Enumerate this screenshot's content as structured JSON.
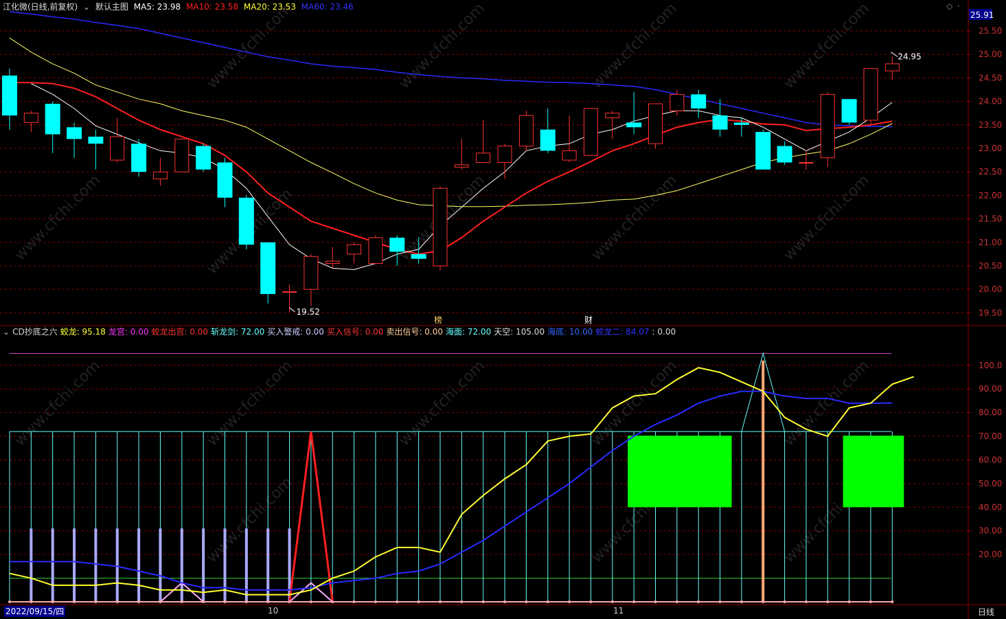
{
  "header": {
    "stock": "江化微(日线,前复权)",
    "icon": "chevron-down-icon",
    "main_label": "默认主图",
    "ma5": "MA5: 23.98",
    "ma10": "MA10: 23.58",
    "ma20": "MA20: 23.53",
    "ma60": "MA60: 23.46",
    "right_icons": [
      "diamond-icon",
      "dot-icon"
    ]
  },
  "indicator_header": {
    "icon": "chevron-down-icon",
    "name": "CD抄底之六",
    "items": [
      {
        "text": "蛟龙: 95.18",
        "color": "#ffff33"
      },
      {
        "text": "龙宫: 0.00",
        "color": "#ff33ff"
      },
      {
        "text": "蛟龙出宫: 0.00",
        "color": "#ff3333"
      },
      {
        "text": "斩龙剑: 72.00",
        "color": "#66ffff"
      },
      {
        "text": "买入警戒: 0.00",
        "color": "#ccccff"
      },
      {
        "text": "买入信号: 0.00",
        "color": "#ff3333"
      },
      {
        "text": "卖出信号: 0.00",
        "color": "#ffcc99"
      },
      {
        "text": "海面: 72.00",
        "color": "#66ffff"
      },
      {
        "text": "天空: 105.00",
        "color": "#dddddd"
      },
      {
        "text": "海底: 10.00",
        "color": "#3366ff"
      },
      {
        "text": "蛟龙二: 84.07",
        "color": "#3333ff"
      },
      {
        "text": ": 0.00",
        "color": "#dddddd"
      }
    ]
  },
  "price_axis": {
    "current": "25.91",
    "labels": [
      "25.50",
      "25.00",
      "24.50",
      "24.00",
      "23.50",
      "23.00",
      "22.50",
      "22.00",
      "21.50",
      "21.00",
      "20.50",
      "20.00",
      "19.50"
    ]
  },
  "indicator_axis": {
    "labels": [
      "100.0",
      "90.00",
      "80.00",
      "70.00",
      "60.00",
      "50.00",
      "40.00",
      "30.00",
      "20.00"
    ]
  },
  "annotations": {
    "high": "24.95",
    "low": "19.52",
    "marker1": "榜",
    "marker2": "财"
  },
  "bottom": {
    "date": "2022/09/15/四",
    "month_oct": "10",
    "month_nov": "11",
    "period": "日线"
  },
  "watermark": "www.cfchi.com",
  "colors": {
    "up": "#ff3232",
    "down": "#00ffff",
    "ma5": "#ffffff",
    "ma10": "#ff2020",
    "ma20": "#ffff66",
    "ma60": "#2a2aff",
    "grid": "#8b0000",
    "sky": "#cc44cc",
    "sea": "#66ffff",
    "seabed": "#33cc33",
    "jiaolong": "#ffff33",
    "jiaolong2": "#2a2aff",
    "green_block": "#00ff00",
    "sell": "#ffaa77",
    "alert": "#aaaaff"
  },
  "chart_data": {
    "type": "candlestick",
    "ylim": [
      19.3,
      25.91
    ],
    "candles": [
      [
        24.55,
        23.7,
        24.7,
        23.4
      ],
      [
        23.55,
        23.75,
        23.8,
        23.35
      ],
      [
        23.95,
        23.3,
        24.0,
        22.9
      ],
      [
        23.45,
        23.2,
        23.55,
        22.8
      ],
      [
        23.25,
        23.1,
        23.4,
        22.55
      ],
      [
        22.75,
        23.25,
        23.65,
        22.7
      ],
      [
        23.1,
        22.5,
        23.2,
        22.4
      ],
      [
        22.35,
        22.5,
        22.8,
        22.2
      ],
      [
        22.5,
        23.2,
        23.2,
        22.5
      ],
      [
        23.05,
        22.55,
        23.1,
        22.5
      ],
      [
        22.7,
        21.95,
        22.8,
        21.75
      ],
      [
        21.95,
        20.95,
        22.0,
        20.85
      ],
      [
        21.0,
        19.9,
        21.0,
        19.7
      ],
      [
        19.95,
        19.95,
        20.1,
        19.52
      ],
      [
        20.0,
        20.7,
        20.75,
        19.65
      ],
      [
        20.55,
        20.6,
        20.9,
        20.45
      ],
      [
        20.75,
        20.95,
        21.0,
        20.55
      ],
      [
        20.55,
        21.1,
        21.15,
        20.55
      ],
      [
        21.1,
        20.8,
        21.15,
        20.5
      ],
      [
        20.75,
        20.65,
        21.1,
        20.55
      ],
      [
        20.5,
        22.15,
        22.2,
        20.4
      ],
      [
        22.6,
        22.65,
        23.2,
        22.55
      ],
      [
        22.7,
        22.9,
        23.6,
        22.7
      ],
      [
        22.7,
        23.05,
        23.1,
        22.35
      ],
      [
        23.05,
        23.7,
        23.8,
        22.95
      ],
      [
        23.4,
        22.95,
        23.85,
        22.9
      ],
      [
        22.75,
        22.95,
        23.7,
        22.7
      ],
      [
        22.85,
        23.85,
        23.85,
        22.85
      ],
      [
        23.65,
        23.75,
        23.8,
        23.2
      ],
      [
        23.55,
        23.45,
        24.2,
        23.3
      ],
      [
        23.1,
        23.95,
        23.95,
        23.0
      ],
      [
        23.8,
        24.15,
        24.25,
        23.7
      ],
      [
        24.15,
        23.85,
        24.25,
        23.65
      ],
      [
        23.7,
        23.4,
        24.05,
        23.25
      ],
      [
        23.55,
        23.5,
        23.65,
        23.25
      ],
      [
        23.35,
        22.55,
        23.4,
        22.55
      ],
      [
        23.05,
        22.7,
        23.15,
        22.65
      ],
      [
        22.7,
        22.7,
        22.95,
        22.55
      ],
      [
        22.8,
        24.15,
        24.2,
        22.6
      ],
      [
        24.05,
        23.55,
        24.05,
        23.5
      ],
      [
        23.6,
        24.7,
        24.7,
        23.5
      ],
      [
        24.65,
        24.8,
        24.95,
        24.45
      ]
    ],
    "ma5": [
      null,
      24.38,
      24.15,
      23.85,
      23.48,
      23.3,
      23.12,
      22.95,
      22.9,
      22.8,
      22.55,
      22.15,
      21.55,
      20.95,
      20.65,
      20.45,
      20.42,
      20.55,
      20.75,
      20.85,
      21.35,
      21.75,
      22.15,
      22.5,
      22.95,
      23.05,
      23.1,
      23.3,
      23.4,
      23.58,
      23.7,
      23.8,
      23.8,
      23.7,
      23.65,
      23.45,
      23.2,
      22.95,
      23.15,
      23.35,
      23.65,
      23.98
    ],
    "ma10": [
      24.4,
      24.4,
      24.38,
      24.28,
      24.1,
      23.85,
      23.6,
      23.4,
      23.25,
      23.1,
      22.85,
      22.5,
      22.05,
      21.75,
      21.45,
      21.3,
      21.15,
      21.0,
      20.85,
      20.75,
      20.82,
      21.1,
      21.45,
      21.75,
      22.05,
      22.3,
      22.5,
      22.72,
      22.95,
      23.1,
      23.28,
      23.45,
      23.55,
      23.62,
      23.58,
      23.52,
      23.5,
      23.38,
      23.42,
      23.45,
      23.5,
      23.58
    ],
    "ma20": [
      25.35,
      25.05,
      24.8,
      24.6,
      24.35,
      24.2,
      24.05,
      23.95,
      23.8,
      23.7,
      23.6,
      23.45,
      23.2,
      22.95,
      22.7,
      22.48,
      22.25,
      22.05,
      21.9,
      21.8,
      21.78,
      21.76,
      21.76,
      21.77,
      21.79,
      21.8,
      21.82,
      21.85,
      21.9,
      21.92,
      22.0,
      22.1,
      22.25,
      22.4,
      22.55,
      22.7,
      22.8,
      22.88,
      22.95,
      23.1,
      23.3,
      23.53
    ],
    "ma60": [
      25.91,
      25.86,
      25.8,
      25.75,
      25.68,
      25.62,
      25.55,
      25.45,
      25.35,
      25.25,
      25.15,
      25.05,
      24.95,
      24.88,
      24.8,
      24.75,
      24.72,
      24.68,
      24.62,
      24.57,
      24.53,
      24.5,
      24.48,
      24.45,
      24.43,
      24.41,
      24.4,
      24.38,
      24.35,
      24.32,
      24.25,
      24.15,
      24.05,
      23.95,
      23.85,
      23.75,
      23.65,
      23.55,
      23.5,
      23.48,
      23.47,
      23.46
    ],
    "ind_ylim": [
      0,
      113
    ],
    "jiaolong": [
      12,
      10,
      7,
      7,
      7,
      8,
      7,
      5,
      5,
      4,
      5,
      3,
      3,
      3,
      5,
      10,
      13,
      19,
      23,
      23,
      21,
      37,
      45,
      52,
      58,
      68,
      70,
      71,
      82,
      87,
      88,
      94,
      99,
      97,
      93,
      89,
      78,
      73,
      70,
      82,
      84,
      92,
      95.18
    ],
    "jiaolong2": [
      17,
      17,
      17,
      17,
      16,
      15,
      13,
      11,
      8,
      6,
      6,
      5,
      5,
      5,
      6,
      8,
      9,
      10,
      12,
      13,
      16,
      21,
      26,
      32,
      38,
      44,
      50,
      57,
      64,
      70,
      75,
      79,
      84,
      87,
      89,
      89,
      87,
      86,
      86,
      84,
      84,
      84.07
    ],
    "sky": 105,
    "sea": 72,
    "seabed": 10,
    "sea_sticks": [
      0,
      1,
      2,
      3,
      4,
      5,
      6,
      7,
      8,
      9,
      10,
      11,
      12,
      13,
      14,
      15,
      16,
      17,
      18,
      19,
      20,
      21,
      22,
      23,
      24,
      25,
      26,
      27,
      28,
      29,
      30,
      31,
      32,
      33,
      34,
      35,
      36,
      37,
      38,
      39,
      40,
      41
    ],
    "alert_sticks": [
      1,
      2,
      3,
      4,
      5,
      6,
      7,
      8,
      9,
      10,
      11,
      12,
      13
    ],
    "buy_spike": {
      "index": 14,
      "value": 72
    },
    "sell_spike": {
      "index": 35,
      "value": 105
    },
    "green_blocks": [
      [
        29,
        33,
        40,
        72
      ],
      [
        39,
        41,
        40,
        72
      ]
    ]
  }
}
